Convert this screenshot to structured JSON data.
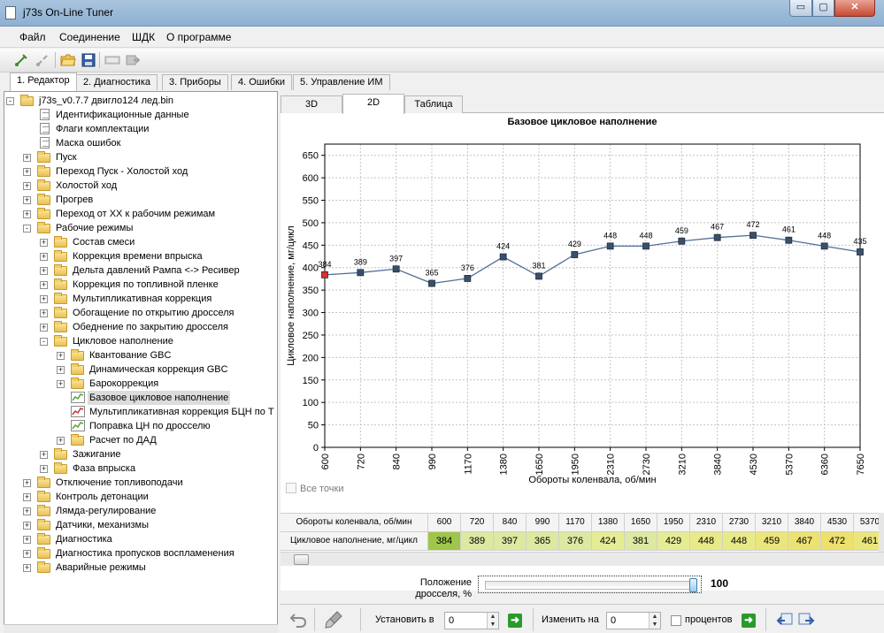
{
  "window": {
    "title": "j73s On-Line Tuner",
    "min_symbol": "▭",
    "max_symbol": "▢",
    "close_symbol": "✕"
  },
  "menu": [
    "Файл",
    "Соединение",
    "ШДК",
    "О программе"
  ],
  "toolbar_icons": [
    "connect-icon",
    "disconnect-icon",
    "open-folder-icon",
    "save-icon",
    "read-ecu-icon",
    "write-ecu-icon"
  ],
  "main_tabs": [
    "1. Редактор",
    "2. Диагностика",
    "3. Приборы",
    "4. Ошибки",
    "5. Управление ИМ"
  ],
  "main_tab_active": 0,
  "tree": [
    {
      "label": "j73s_v0.7.7 двигло124 лед.bin",
      "icon": "folder-open",
      "depth": 0,
      "exp": "-"
    },
    {
      "label": "Идентификационные данные",
      "icon": "doc",
      "depth": 1
    },
    {
      "label": "Флаги комплектации",
      "icon": "doc",
      "depth": 1
    },
    {
      "label": "Маска ошибок",
      "icon": "doc",
      "depth": 1
    },
    {
      "label": "Пуск",
      "icon": "folder",
      "depth": 1,
      "exp": "+"
    },
    {
      "label": "Переход Пуск - Холостой ход",
      "icon": "folder",
      "depth": 1,
      "exp": "+"
    },
    {
      "label": "Холостой ход",
      "icon": "folder",
      "depth": 1,
      "exp": "+"
    },
    {
      "label": "Прогрев",
      "icon": "folder",
      "depth": 1,
      "exp": "+"
    },
    {
      "label": "Переход от ХХ к рабочим режимам",
      "icon": "folder",
      "depth": 1,
      "exp": "+"
    },
    {
      "label": "Рабочие режимы",
      "icon": "folder-open",
      "depth": 1,
      "exp": "-"
    },
    {
      "label": "Состав смеси",
      "icon": "folder",
      "depth": 2,
      "exp": "+"
    },
    {
      "label": "Коррекция времени впрыска",
      "icon": "folder",
      "depth": 2,
      "exp": "+"
    },
    {
      "label": "Дельта давлений Рампа <-> Ресивер",
      "icon": "folder",
      "depth": 2,
      "exp": "+"
    },
    {
      "label": "Коррекция по топливной пленке",
      "icon": "folder",
      "depth": 2,
      "exp": "+"
    },
    {
      "label": "Мультипликативная коррекция",
      "icon": "folder",
      "depth": 2,
      "exp": "+"
    },
    {
      "label": "Обогащение по открытию дросселя",
      "icon": "folder",
      "depth": 2,
      "exp": "+"
    },
    {
      "label": "Обеднение по закрытию дросселя",
      "icon": "folder",
      "depth": 2,
      "exp": "+"
    },
    {
      "label": "Цикловое наполнение",
      "icon": "folder-open",
      "depth": 2,
      "exp": "-"
    },
    {
      "label": "Квантование GBC",
      "icon": "folder",
      "depth": 3,
      "exp": "+"
    },
    {
      "label": "Динамическая коррекция GBC",
      "icon": "folder",
      "depth": 3,
      "exp": "+"
    },
    {
      "label": "Барокоррекция",
      "icon": "folder",
      "depth": 3,
      "exp": "+"
    },
    {
      "label": "Базовое цикловое наполнение",
      "icon": "chart",
      "depth": 3,
      "selected": true
    },
    {
      "label": "Мультипликативная коррекция БЦН по Т",
      "icon": "chart-red",
      "depth": 3
    },
    {
      "label": "Поправка ЦН по дросселю",
      "icon": "chart",
      "depth": 3
    },
    {
      "label": "Расчет по ДАД",
      "icon": "folder",
      "depth": 3,
      "exp": "+"
    },
    {
      "label": "Зажигание",
      "icon": "folder",
      "depth": 2,
      "exp": "+"
    },
    {
      "label": "Фаза впрыска",
      "icon": "folder",
      "depth": 2,
      "exp": "+"
    },
    {
      "label": "Отключение топливоподачи",
      "icon": "folder",
      "depth": 1,
      "exp": "+"
    },
    {
      "label": "Контроль детонации",
      "icon": "folder",
      "depth": 1,
      "exp": "+"
    },
    {
      "label": "Лямда-регулирование",
      "icon": "folder",
      "depth": 1,
      "exp": "+"
    },
    {
      "label": "Датчики, механизмы",
      "icon": "folder",
      "depth": 1,
      "exp": "+"
    },
    {
      "label": "Диагностика",
      "icon": "folder",
      "depth": 1,
      "exp": "+"
    },
    {
      "label": "Диагностика пропусков воспламенения",
      "icon": "folder",
      "depth": 1,
      "exp": "+"
    },
    {
      "label": "Аварийные режимы",
      "icon": "folder",
      "depth": 1,
      "exp": "+"
    }
  ],
  "sub_tabs": [
    "3D",
    "2D",
    "Таблица"
  ],
  "sub_tab_active": 1,
  "chart_data": {
    "type": "line",
    "title": "Базовое цикловое наполнение",
    "xlabel": "Обороты коленвала, об/мин",
    "ylabel": "Цикловое наполнение, мг/цикл",
    "categories": [
      "600",
      "720",
      "840",
      "990",
      "1170",
      "1380",
      "1650",
      "1950",
      "2310",
      "2730",
      "3210",
      "3840",
      "4530",
      "5370",
      "6360",
      "7650"
    ],
    "series": [
      {
        "name": "Цикловое наполнение, мг/цикл",
        "values": [
          384,
          389,
          397,
          365,
          376,
          424,
          381,
          429,
          448,
          448,
          459,
          467,
          472,
          461,
          448,
          435
        ]
      }
    ],
    "ylim": [
      0,
      675
    ],
    "yticks": [
      0,
      50,
      100,
      150,
      200,
      250,
      300,
      350,
      400,
      450,
      500,
      550,
      600,
      650
    ],
    "grid": true,
    "selected_point_index": 0,
    "line_color": "#4f7197",
    "marker_color": "#39506b",
    "selected_marker_color": "#d93030"
  },
  "all_points_label": "Все точки",
  "table": {
    "row_headers": [
      "Обороты коленвала, об/мин",
      "Цикловое наполнение, мг/цикл"
    ],
    "columns": [
      "600",
      "720",
      "840",
      "990",
      "1170",
      "1380",
      "1650",
      "1950",
      "2310",
      "2730",
      "3210",
      "3840",
      "4530",
      "5370"
    ],
    "values": [
      "384",
      "389",
      "397",
      "365",
      "376",
      "424",
      "381",
      "429",
      "448",
      "448",
      "459",
      "467",
      "472",
      "461"
    ],
    "cell_colors": [
      "#9fc64a",
      "#dce9a0",
      "#dce9a0",
      "#dce9a0",
      "#dce9a0",
      "#e5ec94",
      "#dce9a0",
      "#e5ec94",
      "#e8ea88",
      "#e8ea88",
      "#ebe67c",
      "#ece272",
      "#ede06c",
      "#ebe67c"
    ]
  },
  "throttle": {
    "label": "Положение дросселя, %",
    "value_text": "100",
    "value_fraction": 1.0
  },
  "bottom": {
    "set_label": "Установить в",
    "set_value": "0",
    "change_label": "Изменить на",
    "change_value": "0",
    "percent_label": "процентов"
  }
}
